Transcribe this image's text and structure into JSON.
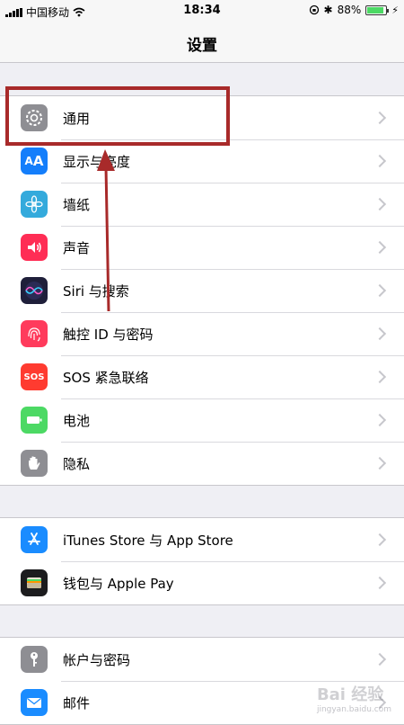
{
  "status": {
    "carrier": "中国移动",
    "time": "18:34",
    "battery": "88%",
    "battery_level": 0.88
  },
  "nav": {
    "title": "设置"
  },
  "groups": [
    {
      "rows": [
        {
          "label": "通用",
          "icon": "gear-icon",
          "color": "#8e8e93"
        },
        {
          "label": "显示与亮度",
          "icon": "aa-icon",
          "color": "#147efb"
        },
        {
          "label": "墙纸",
          "icon": "flower-icon",
          "color": "#34aadc"
        },
        {
          "label": "声音",
          "icon": "speaker-icon",
          "color": "#ff2d55"
        },
        {
          "label": "Siri 与搜索",
          "icon": "siri-icon",
          "color": "#1f1f3a"
        },
        {
          "label": "触控 ID 与密码",
          "icon": "fingerprint-icon",
          "color": "#ff3b5c"
        },
        {
          "label": "SOS 紧急联络",
          "icon": "sos-icon",
          "color": "#ff3b30"
        },
        {
          "label": "电池",
          "icon": "battery-icon",
          "color": "#4cd964"
        },
        {
          "label": "隐私",
          "icon": "hand-icon",
          "color": "#8e8e93"
        }
      ]
    },
    {
      "rows": [
        {
          "label": "iTunes Store 与 App Store",
          "icon": "app-store-icon",
          "color": "#1a8cff"
        },
        {
          "label": "钱包与 Apple Pay",
          "icon": "wallet-icon",
          "color": "#1c1c1e"
        }
      ]
    },
    {
      "rows": [
        {
          "label": "帐户与密码",
          "icon": "key-icon",
          "color": "#8e8e93"
        },
        {
          "label": "邮件",
          "icon": "mail-icon",
          "color": "#1a8cff"
        }
      ]
    }
  ],
  "annotation": {
    "color": "#a82a2a",
    "highlighted_row": "通用"
  },
  "watermark": {
    "text": "Bai 经验",
    "sub": "jingyan.baidu.com"
  }
}
